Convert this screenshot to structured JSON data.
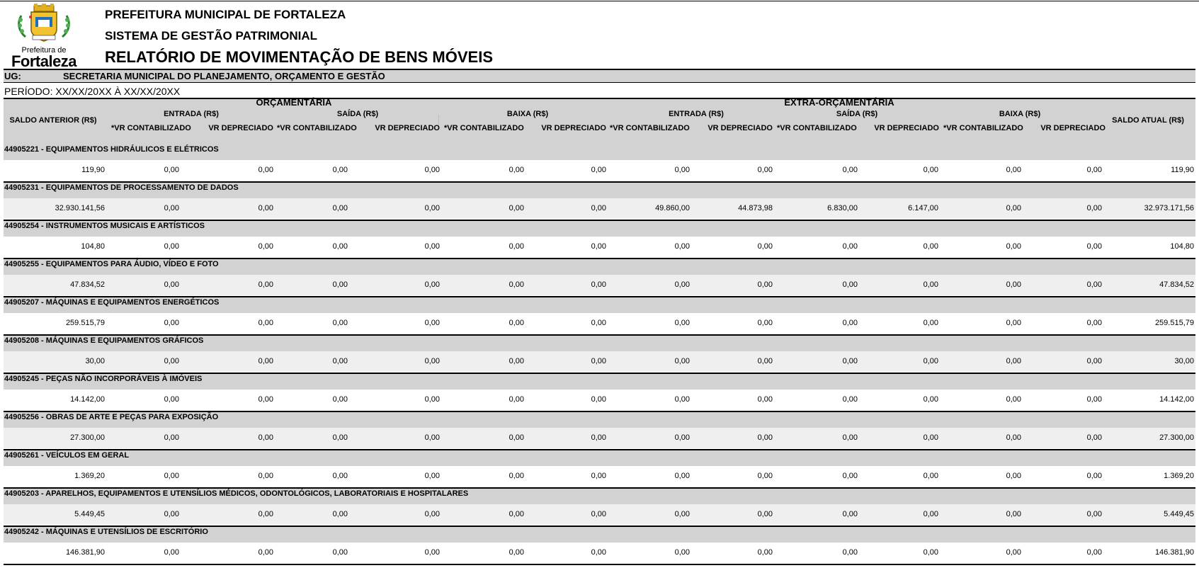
{
  "header": {
    "org": "PREFEITURA MUNICIPAL DE FORTALEZA",
    "system": "SISTEMA DE GESTÃO PATRIMONIAL",
    "report_title": "RELATÓRIO DE MOVIMENTAÇÃO DE BENS MÓVEIS",
    "logo_text_small": "Prefeitura de",
    "logo_text_big": "Fortaleza"
  },
  "ug": {
    "label": "UG:",
    "value": "SECRETARIA MUNICIPAL DO PLANEJAMENTO, ORÇAMENTO E GESTÃO"
  },
  "periodo": {
    "label": "PERÍODO:",
    "value": "XX/XX/20XX À XX/XX/20XX"
  },
  "table": {
    "group_orc": "ORÇAMENTÁRIA",
    "group_extra": "EXTRA-ORÇAMENTÁRIA",
    "saldo_anterior": "SALDO ANTERIOR (R$)",
    "saldo_atual": "SALDO ATUAL (R$)",
    "entrada": "ENTRADA (R$)",
    "saida": "SAÍDA (R$)",
    "baixa": "BAIXA (R$)",
    "entrada_extra": "ENTRADA  (R$)",
    "saida_extra": "SAÍDA  (R$)",
    "baixa_extra": "BAIXA (R$)",
    "vr_contabilizado": "*VR CONTABILIZADO",
    "vr_depreciado": "VR DEPRECIADO"
  },
  "groups": [
    {
      "title": "44905221 - EQUIPAMENTOS HIDRÁULICOS E ELÉTRICOS",
      "values": [
        "119,90",
        "0,00",
        "0,00",
        "0,00",
        "0,00",
        "0,00",
        "0,00",
        "0,00",
        "0,00",
        "0,00",
        "0,00",
        "0,00",
        "0,00",
        "119,90"
      ]
    },
    {
      "title": "44905231 - EQUIPAMENTOS DE PROCESSAMENTO DE DADOS",
      "values": [
        "32.930.141,56",
        "0,00",
        "0,00",
        "0,00",
        "0,00",
        "0,00",
        "0,00",
        "49.860,00",
        "44.873,98",
        "6.830,00",
        "6.147,00",
        "0,00",
        "0,00",
        "32.973.171,56"
      ]
    },
    {
      "title": "44905254 - INSTRUMENTOS MUSICAIS E ARTÍSTICOS",
      "values": [
        "104,80",
        "0,00",
        "0,00",
        "0,00",
        "0,00",
        "0,00",
        "0,00",
        "0,00",
        "0,00",
        "0,00",
        "0,00",
        "0,00",
        "0,00",
        "104,80"
      ]
    },
    {
      "title": "44905255 - EQUIPAMENTOS PARA  ÁUDIO, VÍDEO E FOTO",
      "values": [
        "47.834,52",
        "0,00",
        "0,00",
        "0,00",
        "0,00",
        "0,00",
        "0,00",
        "0,00",
        "0,00",
        "0,00",
        "0,00",
        "0,00",
        "0,00",
        "47.834,52"
      ]
    },
    {
      "title": "44905207 - MÁQUINAS E EQUIPAMENTOS ENERGÉTICOS",
      "values": [
        "259.515,79",
        "0,00",
        "0,00",
        "0,00",
        "0,00",
        "0,00",
        "0,00",
        "0,00",
        "0,00",
        "0,00",
        "0,00",
        "0,00",
        "0,00",
        "259.515,79"
      ]
    },
    {
      "title": "44905208 - MÁQUINAS E EQUIPAMENTOS  GRÁFICOS",
      "values": [
        "30,00",
        "0,00",
        "0,00",
        "0,00",
        "0,00",
        "0,00",
        "0,00",
        "0,00",
        "0,00",
        "0,00",
        "0,00",
        "0,00",
        "0,00",
        "30,00"
      ]
    },
    {
      "title": "44905245 - PEÇAS NÃO INCORPORÁVEIS À IMÓVEIS",
      "values": [
        "14.142,00",
        "0,00",
        "0,00",
        "0,00",
        "0,00",
        "0,00",
        "0,00",
        "0,00",
        "0,00",
        "0,00",
        "0,00",
        "0,00",
        "0,00",
        "14.142,00"
      ]
    },
    {
      "title": "44905256 - OBRAS DE ARTE E PEÇAS PARA EXPOSIÇÃO",
      "values": [
        "27.300,00",
        "0,00",
        "0,00",
        "0,00",
        "0,00",
        "0,00",
        "0,00",
        "0,00",
        "0,00",
        "0,00",
        "0,00",
        "0,00",
        "0,00",
        "27.300,00"
      ]
    },
    {
      "title": "44905261 - VEÍCULOS EM GERAL",
      "values": [
        "1.369,20",
        "0,00",
        "0,00",
        "0,00",
        "0,00",
        "0,00",
        "0,00",
        "0,00",
        "0,00",
        "0,00",
        "0,00",
        "0,00",
        "0,00",
        "1.369,20"
      ]
    },
    {
      "title": "44905203 - APARELHOS, EQUIPAMENTOS E UTENSÍLIOS MÉDICOS, ODONTOLÓGICOS, LABORATORIAIS E HOSPITALARES",
      "values": [
        "5.449,45",
        "0,00",
        "0,00",
        "0,00",
        "0,00",
        "0,00",
        "0,00",
        "0,00",
        "0,00",
        "0,00",
        "0,00",
        "0,00",
        "0,00",
        "5.449,45"
      ]
    },
    {
      "title": "44905242 - MÁQUINAS E UTENSÍLIOS  DE ESCRITÓRIO",
      "values": [
        "146.381,90",
        "0,00",
        "0,00",
        "0,00",
        "0,00",
        "0,00",
        "0,00",
        "0,00",
        "0,00",
        "0,00",
        "0,00",
        "0,00",
        "0,00",
        "146.381,90"
      ]
    }
  ]
}
